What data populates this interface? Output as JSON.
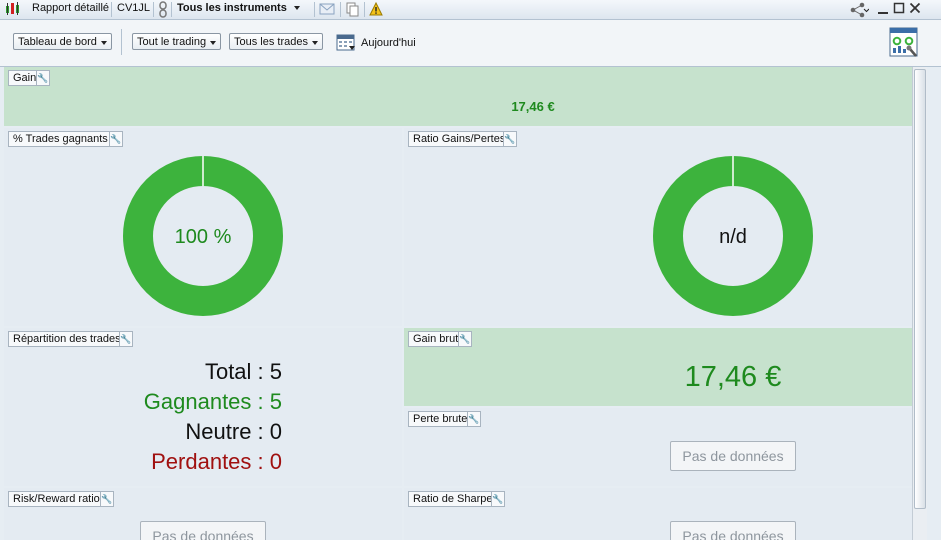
{
  "titlebar": {
    "report_label": "Rapport détaillé",
    "account": "CV1JL",
    "instruments": "Tous les instruments"
  },
  "toolbar": {
    "view_select": "Tableau de bord",
    "trading_select": "Tout le trading",
    "trades_select": "Tous les trades",
    "date_label": "Aujourd'hui"
  },
  "panels": {
    "gain": {
      "title": "Gain",
      "value": "17,46 €"
    },
    "win_pct": {
      "title": "% Trades gagnants",
      "value": "100 %",
      "fraction": 1.0
    },
    "ratio": {
      "title": "Ratio Gains/Pertes",
      "value": "n/d"
    },
    "distribution": {
      "title": "Répartition des trades",
      "total_label": "Total : 5",
      "win_label": "Gagnantes : 5",
      "neutral_label": "Neutre : 0",
      "loss_label": "Perdantes : 0"
    },
    "gross_gain": {
      "title": "Gain brut",
      "value": "17,46 €"
    },
    "gross_loss": {
      "title": "Perte brute",
      "nodata": "Pas de données"
    },
    "risk_reward": {
      "title": "Risk/Reward ratio",
      "nodata": "Pas de données"
    },
    "sharpe": {
      "title": "Ratio de Sharpe",
      "nodata": "Pas de données"
    }
  },
  "colors": {
    "donut": "#3db33d",
    "positive": "#1e8a1e",
    "negative": "#a01010",
    "highlight_panel": "#c6e2cd"
  },
  "icons": [
    "chart-icon",
    "link-icon",
    "dropdown-arrow-icon",
    "email-icon",
    "copy-icon",
    "warning-icon",
    "share-icon",
    "minimize-icon",
    "maximize-icon",
    "close-icon",
    "calendar-icon",
    "dashboard-settings-icon",
    "wrench-icon"
  ]
}
